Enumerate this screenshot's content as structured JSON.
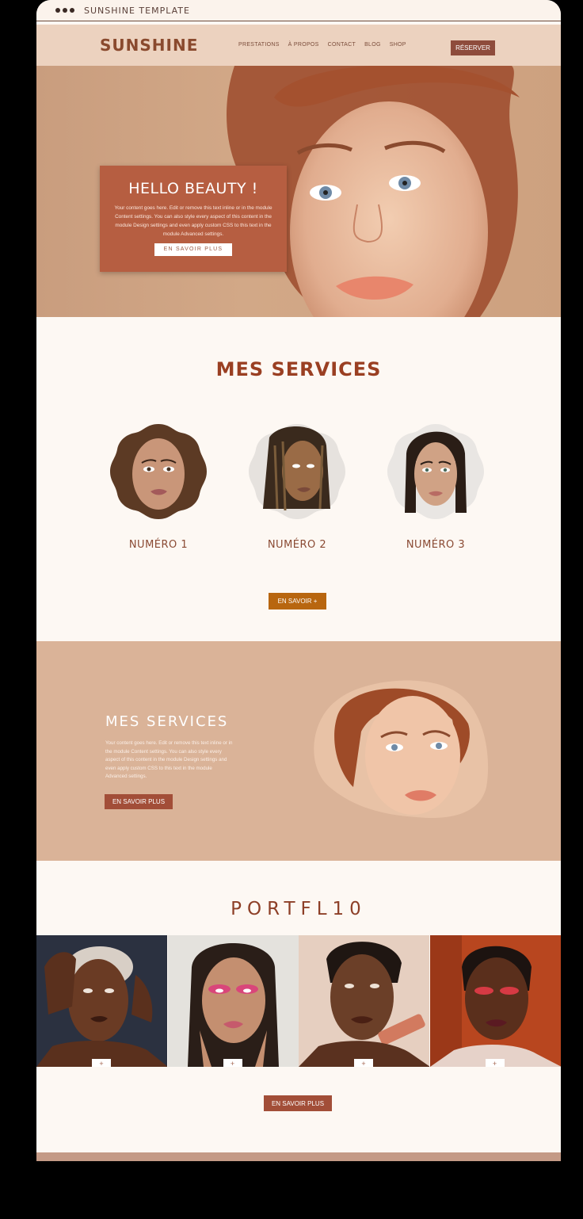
{
  "window": {
    "title": "SUNSHINE TEMPLATE"
  },
  "nav": {
    "logo": "SUNSHINE",
    "items": [
      {
        "label": "PRESTATIONS"
      },
      {
        "label": "À PROPOS"
      },
      {
        "label": "CONTACT"
      },
      {
        "label": "BLOG"
      },
      {
        "label": "SHOP"
      }
    ],
    "cta": "RÉSERVER"
  },
  "hero": {
    "title": "HELLO BEAUTY !",
    "body": "Your content goes here. Edit or remove this text inline or in the module Content settings. You can also style every aspect of this content in the module Design settings and even apply custom CSS to this text in the module Advanced settings.",
    "button": "EN SAVOIR PLUS"
  },
  "services": {
    "title": "MES SERVICES",
    "items": [
      {
        "label": "NUMÉRO 1"
      },
      {
        "label": "NUMÉRO 2"
      },
      {
        "label": "NUMÉRO 3"
      }
    ],
    "button": "EN SAVOIR +"
  },
  "about": {
    "title": "MES SERVICES",
    "body": "Your content goes here. Edit or remove this text inline or in the module Content settings. You can also style every aspect of this content in the module Design settings and even apply custom CSS to this text in the module Advanced settings.",
    "button": "EN SAVOIR PLUS"
  },
  "portfolio": {
    "title": "PORTFL10",
    "items": [
      {
        "plus": "+"
      },
      {
        "plus": "+"
      },
      {
        "plus": "+"
      },
      {
        "plus": "+"
      }
    ],
    "button": "EN SAVOIR PLUS"
  },
  "colors": {
    "brand": "#9a3f22",
    "hero_card": "#b65e41",
    "band": "#dab398",
    "gold_button": "#b8660f"
  }
}
